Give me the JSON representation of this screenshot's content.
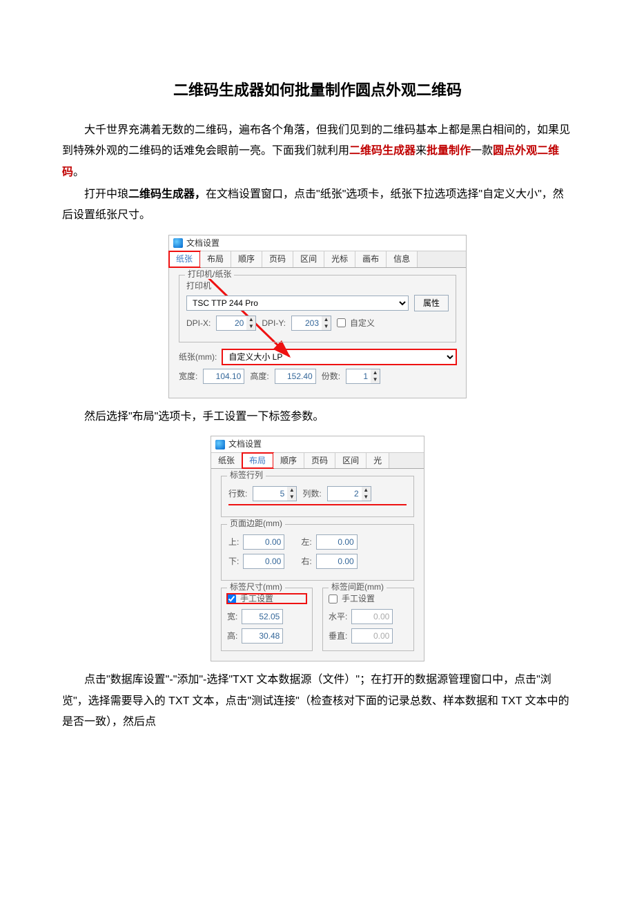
{
  "title": "二维码生成器如何批量制作圆点外观二维码",
  "p1a": "大千世界充满着无数的二维码，遍布各个角落，但我们见到的二维码基本上都是黑白相间的，如果见到特殊外观的二维码的话难免会眼前一亮。下面我们就利用",
  "p1_r1": "二维码生成器",
  "p1b": "来",
  "p1_r2": "批量制作",
  "p1c": "一款",
  "p1_r3": "圆点外观二维码",
  "p1d": "。",
  "p2a": "打开中琅",
  "p2_bold": "二维码生成器，",
  "p2b": "在文档设置窗口，点击\"纸张\"选项卡，纸张下拉选项选择\"自定义大小\"，然后设置纸张尺寸。",
  "p3": "然后选择\"布局\"选项卡，手工设置一下标签参数。",
  "p4": "点击\"数据库设置\"-\"添加\"-选择\"TXT 文本数据源（文件）\"；在打开的数据源管理窗口中，点击\"浏览\"，选择需要导入的 TXT 文本，点击\"测试连接\"（检查核对下面的记录总数、样本数据和 TXT 文本中的是否一致），然后点",
  "dlg": {
    "title": "文档设置",
    "tabs": [
      "纸张",
      "布局",
      "顺序",
      "页码",
      "区间",
      "光标",
      "画布",
      "信息"
    ],
    "d1": {
      "legend": "打印机/纸张",
      "printer_lbl": "打印机",
      "printer": "TSC TTP 244 Pro",
      "prop_btn": "属性",
      "dpix_lbl": "DPI-X:",
      "dpix": "20",
      "dpiy_lbl": "DPI-Y:",
      "dpiy": "203",
      "custom_chk": "自定义",
      "paper_lbl": "纸张(mm):",
      "paper_sel": "自定义大小 LP",
      "width_lbl": "宽度:",
      "width": "104.10",
      "height_lbl": "高度:",
      "height": "152.40",
      "copies_lbl": "份数:",
      "copies": "1"
    },
    "d2": {
      "tabs_vis": [
        "纸张",
        "布局",
        "顺序",
        "页码",
        "区间",
        "光"
      ],
      "rowcol_legend": "标签行列",
      "rows_lbl": "行数:",
      "rows": "5",
      "cols_lbl": "列数:",
      "cols": "2",
      "margin_legend": "页面边距(mm)",
      "top_lbl": "上:",
      "top": "0.00",
      "left_lbl": "左:",
      "left": "0.00",
      "bottom_lbl": "下:",
      "bottom": "0.00",
      "right_lbl": "右:",
      "right": "0.00",
      "size_legend": "标签尺寸(mm)",
      "gap_legend": "标签间距(mm)",
      "manual": "手工设置",
      "w_lbl": "宽:",
      "w": "52.05",
      "h_lbl": "高:",
      "h": "30.48",
      "hgap_lbl": "水平:",
      "hgap": "0.00",
      "vgap_lbl": "垂直:",
      "vgap": "0.00"
    }
  }
}
